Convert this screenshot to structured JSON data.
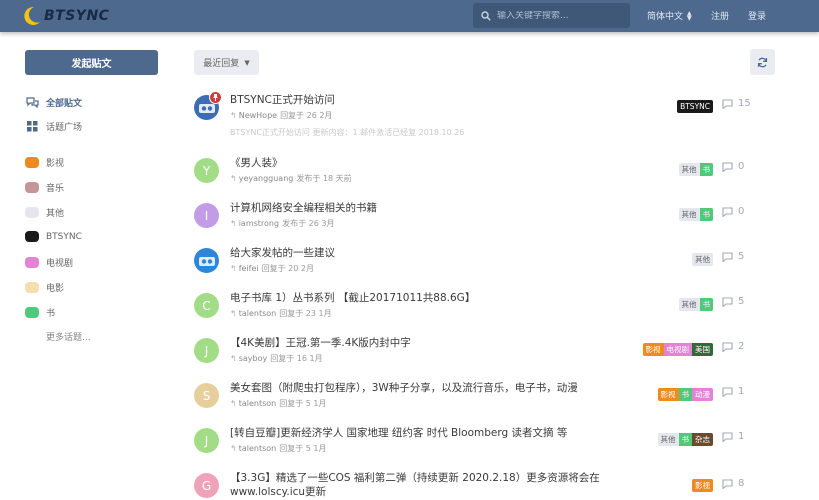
{
  "header": {
    "logo_text": "BTSYNC",
    "search_placeholder": "输入关键字搜索...",
    "language": "简体中文",
    "register": "注册",
    "login": "登录"
  },
  "sidebar": {
    "new_post": "发起贴文",
    "all_posts": "全部贴文",
    "topic_square": "话题广场",
    "tags": [
      {
        "label": "影视",
        "color": "#ee8a1e"
      },
      {
        "label": "音乐",
        "color": "#c4969a"
      },
      {
        "label": "其他",
        "color": "#e4e8ee"
      },
      {
        "label": "BTSYNC",
        "color": "#1a1a1a"
      },
      {
        "label": "电视剧",
        "color": "#e283d6"
      },
      {
        "label": "电影",
        "color": "#f5deb0"
      },
      {
        "label": "书",
        "color": "#51c97b"
      }
    ],
    "more_topics": "更多话题..."
  },
  "toolbar": {
    "sort_label": "最近回复"
  },
  "posts": [
    {
      "title": "BTSYNC正式开始访问",
      "author": "NewHope",
      "action": "回复于 26 2月",
      "excerpt": "BTSYNC正式开始访问 更新内容：1.邮件激活已经复 2018.10.26",
      "tags": [
        {
          "label": "BTSYNC",
          "bg": "#1a1a1a",
          "fg": "#ffffff"
        }
      ],
      "count": "15",
      "avatar_letter": "",
      "avatar_color": "#3b6db5"
    },
    {
      "title": "《男人装》",
      "author": "yeyangguang",
      "action": "发布于 18 天前",
      "tags": [
        {
          "label": "其他",
          "bg": "#e4e8ee",
          "fg": "#666666"
        },
        {
          "label": "书",
          "bg": "#51c97b",
          "fg": "#ffffff"
        }
      ],
      "count": "0",
      "avatar_letter": "Y",
      "avatar_color": "#a3dc86"
    },
    {
      "title": "计算机网络安全编程相关的书籍",
      "author": "iamstrong",
      "action": "发布于 26 3月",
      "tags": [
        {
          "label": "其他",
          "bg": "#e4e8ee",
          "fg": "#666666"
        },
        {
          "label": "书",
          "bg": "#51c97b",
          "fg": "#ffffff"
        }
      ],
      "count": "0",
      "avatar_letter": "I",
      "avatar_color": "#c39ce6"
    },
    {
      "title": "给大家发帖的一些建议",
      "author": "feifei",
      "action": "回复于 20 2月",
      "tags": [
        {
          "label": "其他",
          "bg": "#e4e8ee",
          "fg": "#666666"
        }
      ],
      "count": "5",
      "avatar_letter": "",
      "avatar_color": "#2f86d6"
    },
    {
      "title": "电子书库 1）丛书系列 【截止20171011共88.6G】",
      "author": "talentson",
      "action": "回复于 23 1月",
      "tags": [
        {
          "label": "其他",
          "bg": "#e4e8ee",
          "fg": "#666666"
        },
        {
          "label": "书",
          "bg": "#51c97b",
          "fg": "#ffffff"
        }
      ],
      "count": "5",
      "avatar_letter": "C",
      "avatar_color": "#a3dc86"
    },
    {
      "title": "【4K美剧】王冠.第一季.4K版内封中字",
      "author": "sayboy",
      "action": "回复于 16 1月",
      "tags": [
        {
          "label": "影视",
          "bg": "#ee8a1e",
          "fg": "#ffffff"
        },
        {
          "label": "电视剧",
          "bg": "#e283d6",
          "fg": "#ffffff"
        },
        {
          "label": "美国",
          "bg": "#2f6b3a",
          "fg": "#ffffff"
        }
      ],
      "count": "2",
      "avatar_letter": "J",
      "avatar_color": "#a3dc86"
    },
    {
      "title": "美女套图（附爬虫打包程序），3W种子分享，以及流行音乐，电子书，动漫",
      "author": "talentson",
      "action": "回复于 5 1月",
      "tags": [
        {
          "label": "影视",
          "bg": "#ee8a1e",
          "fg": "#ffffff"
        },
        {
          "label": "书",
          "bg": "#51c97b",
          "fg": "#ffffff"
        },
        {
          "label": "动漫",
          "bg": "#e283d6",
          "fg": "#ffffff"
        }
      ],
      "count": "1",
      "avatar_letter": "S",
      "avatar_color": "#e6cf9c"
    },
    {
      "title": "[转自豆瓣]更新经济学人 国家地理 纽约客 时代 Bloomberg 读者文摘 等",
      "author": "talentson",
      "action": "回复于 5 1月",
      "tags": [
        {
          "label": "其他",
          "bg": "#e4e8ee",
          "fg": "#666666"
        },
        {
          "label": "书",
          "bg": "#51c97b",
          "fg": "#ffffff"
        },
        {
          "label": "杂志",
          "bg": "#6b4a2f",
          "fg": "#ffffff"
        }
      ],
      "count": "1",
      "avatar_letter": "J",
      "avatar_color": "#a3dc86"
    },
    {
      "title": "【3.3G】精选了一些COS 福利第二弹（持续更新 2020.2.18）更多资源将会在www.lolscy.icu更新",
      "author": "",
      "action": "",
      "tags": [
        {
          "label": "影视",
          "bg": "#ee8a1e",
          "fg": "#ffffff"
        }
      ],
      "count": "8",
      "avatar_letter": "G",
      "avatar_color": "#f0a3b8"
    }
  ]
}
